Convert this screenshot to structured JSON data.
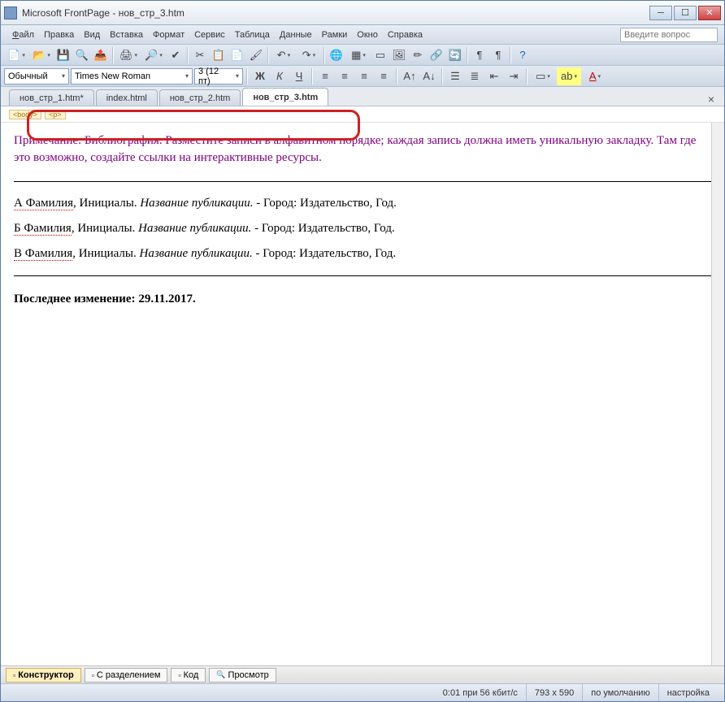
{
  "window": {
    "app_name": "Microsoft FrontPage",
    "doc_name": "нов_стр_3.htm"
  },
  "menu": {
    "file": "Файл",
    "edit": "Правка",
    "view": "Вид",
    "insert": "Вставка",
    "format": "Формат",
    "tools": "Сервис",
    "table": "Таблица",
    "data": "Данные",
    "frames": "Рамки",
    "window": "Окно",
    "help": "Справка"
  },
  "help_search_placeholder": "Введите вопрос",
  "format_bar": {
    "style": "Обычный",
    "font": "Times New Roman",
    "size": "3 (12 пт)"
  },
  "tabs": [
    {
      "label": "нов_стр_1.htm*",
      "active": false
    },
    {
      "label": "index.html",
      "active": false
    },
    {
      "label": "нов_стр_2.htm",
      "active": false
    },
    {
      "label": "нов_стр_3.htm",
      "active": true
    }
  ],
  "breadcrumb": {
    "body": "<body>",
    "p": "<p>"
  },
  "content": {
    "note": "Примечание: Библиография. Разместите записи в алфавитном порядке; каждая запись должна иметь уникальную закладку. Там где это возможно, создайте ссылки на интерактивные ресурсы.",
    "entries": [
      {
        "surname": "А Фамилия",
        "initials": ", Инициалы. ",
        "title": "Название публикации.",
        "rest": " - Город: Издательство, Год."
      },
      {
        "surname": "Б Фамилия",
        "initials": ", Инициалы. ",
        "title": "Название публикации.",
        "rest": " - Город: Издательство, Год."
      },
      {
        "surname": "В Фамилия",
        "initials": ", Инициалы. ",
        "title": "Название публикации.",
        "rest": " - Город: Издательство, Год."
      }
    ],
    "last_modified_label": "Последнее изменение: ",
    "last_modified_date": "29.11.2017."
  },
  "view_tabs": {
    "design": "Конструктор",
    "split": "С разделением",
    "code": "Код",
    "preview": "Просмотр"
  },
  "status": {
    "time_speed": "0:01 при 56 кбит/с",
    "dimensions": "793 x 590",
    "mode": "по умолчанию",
    "setup": "настройка"
  }
}
